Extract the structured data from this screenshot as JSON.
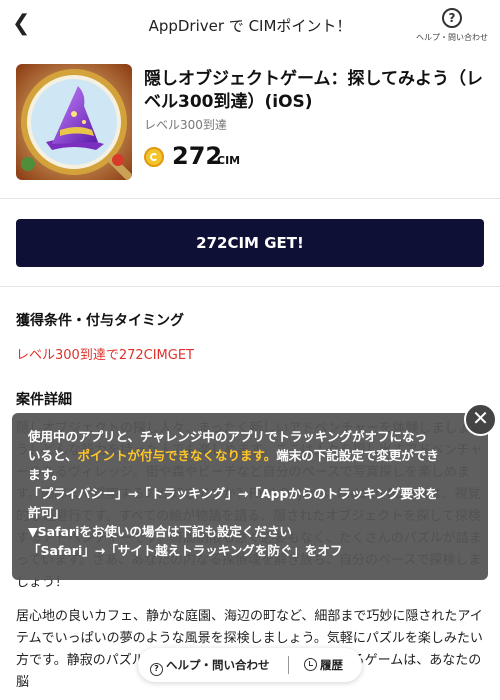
{
  "header": {
    "title": "AppDriver で CIMポイント！",
    "help_label": "ヘルプ・問い合わせ"
  },
  "app": {
    "name": "隠しオブジェクトゲーム：探してみよう（レベル300到達）(iOS)",
    "subtitle": "レベル300到達",
    "points": "272",
    "points_unit": "CIM"
  },
  "cta": {
    "label": "272CIM GET!"
  },
  "conditions": {
    "title": "獲得条件・付与タイミング",
    "text": "レベル300到達で272CIMGET"
  },
  "details": {
    "title": "案件詳細",
    "para1": "隠しオブジェクトの探し人々、まったく新しいアドベンチャーを体験しましょう！どんな能力を持った人でも楽しめます。ここは人々を探し出すアドベンチャーのあるヴィレッジ。街や森やビーチなど自分のペースで写真探しを楽しめます。細部まで観察するのが好きですか？Find Objects: Hidden Puzzleは、視覚的な逃避行です。すべての絵が物語を語る、隠されたオブジェクトを探して探検するアドベンチャーです。時間制限も急ぐ必要もなく、たくさんのパズルが詰まっています。さあ、あなたの内なる探偵魂を解き放ち、自分のペースで探検しましょう！",
    "para2": "居心地の良いカフェ、静かな庭園、海辺の町など、細部まで巧妙に隠されたアイテムでいっぱいの夢のような風景を探検しましょう。気軽にパズルを楽しみたい方です。静寂のパズル好きの方でも、このリラックスできるゲームは、あなたの脳"
  },
  "overlay": {
    "line1": "使用中のアプリと、チャレンジ中のアプリでトラッキングがオフになっ",
    "line2a": "いると、",
    "line2_highlight": "ポイントが付与できなくなります。",
    "line2b": "端末の下記設定で変更ができ",
    "line3": "ます。",
    "line4": "「プライバシー」→「トラッキング」→「Appからのトラッキング要求を",
    "line5": "許可」",
    "line6": "▼Safariをお使いの場合は下記も設定ください",
    "line7": "「Safari」→「サイト越えトラッキングを防ぐ」をオフ",
    "highlight_color": "#ffc629"
  },
  "bottom_bar": {
    "help_label": "ヘルプ・問い合わせ",
    "history_label": "履歴"
  },
  "colors": {
    "cta_bg": "#0f1035",
    "condition_text": "#e0312b",
    "coin": "#f3c32c"
  }
}
